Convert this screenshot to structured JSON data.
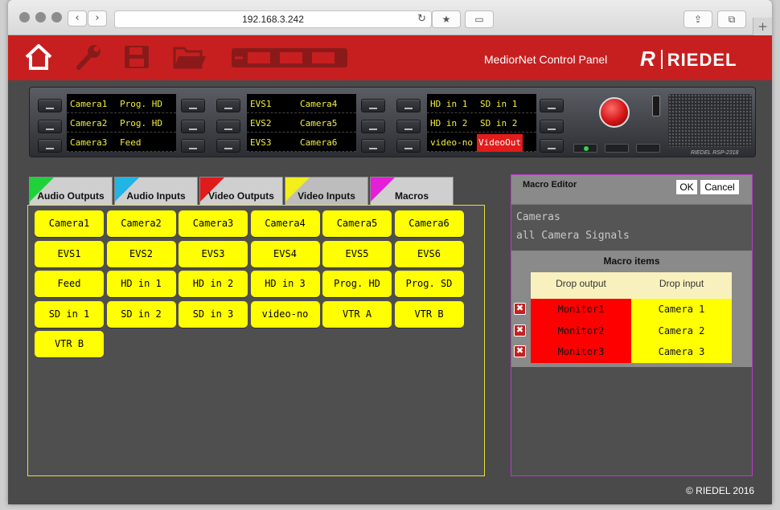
{
  "browser": {
    "url": "192.168.3.242",
    "back": "‹",
    "forward": "›",
    "reload": "↻",
    "bookmark": "★",
    "sidebar": "▭",
    "share": "⇪",
    "tabs": "⧉",
    "new_tab": "+"
  },
  "header": {
    "title": "MediorNet Control Panel",
    "logo_mark": "R",
    "logo_text": "RIEDEL",
    "icons": [
      "home-icon",
      "wrench-icon",
      "save-icon",
      "folder-icon",
      "device-icon"
    ]
  },
  "device": {
    "displays": [
      {
        "rows": [
          [
            "Camera1",
            "Prog. HD"
          ],
          [
            "Camera2",
            "Prog. HD"
          ],
          [
            "Camera3",
            "Feed"
          ]
        ]
      },
      {
        "rows": [
          [
            "EVS1",
            "Camera4"
          ],
          [
            "EVS2",
            "Camera5"
          ],
          [
            "EVS3",
            "Camera6"
          ]
        ]
      },
      {
        "rows": [
          [
            "HD in 1",
            "SD in 1"
          ],
          [
            "HD in 2",
            "SD in 2"
          ],
          [
            "video-no",
            "VideoOut"
          ]
        ]
      }
    ],
    "highlighted_cell": "VideoOut",
    "model_label": "RIEDEL RSP-2318"
  },
  "tabs": [
    {
      "label": "Audio Outputs",
      "color": "#1fd13a"
    },
    {
      "label": "Audio Inputs",
      "color": "#1fb6e6"
    },
    {
      "label": "Video Outputs",
      "color": "#e01b1b"
    },
    {
      "label": "Video Inputs",
      "color": "#f2ef1a"
    },
    {
      "label": "Macros",
      "color": "#e51ed8"
    }
  ],
  "active_tab": "Video Inputs",
  "signals": [
    "Camera1",
    "Camera2",
    "Camera3",
    "Camera4",
    "Camera5",
    "Camera6",
    "EVS1",
    "EVS2",
    "EVS3",
    "EVS4",
    "EVS5",
    "EVS6",
    "Feed",
    "HD in 1",
    "HD in 2",
    "HD in 3",
    "Prog. HD",
    "Prog. SD",
    "SD in 1",
    "SD in 2",
    "SD in 3",
    "video-no",
    "VTR A",
    "VTR B",
    "VTR B"
  ],
  "macro_editor": {
    "title": "Macro Editor",
    "ok_label": "OK",
    "cancel_label": "Cancel",
    "name": "Cameras",
    "description": "all Camera Signals",
    "items_title": "Macro items",
    "col_output": "Drop output",
    "col_input": "Drop input",
    "delete_glyph": "✖",
    "items": [
      {
        "output": "Monitor1",
        "input": "Camera 1"
      },
      {
        "output": "Monitor2",
        "input": "Camera 2"
      },
      {
        "output": "Monitor3",
        "input": "Camera 3"
      }
    ]
  },
  "footer": {
    "copyright": "© RIEDEL 2016"
  }
}
